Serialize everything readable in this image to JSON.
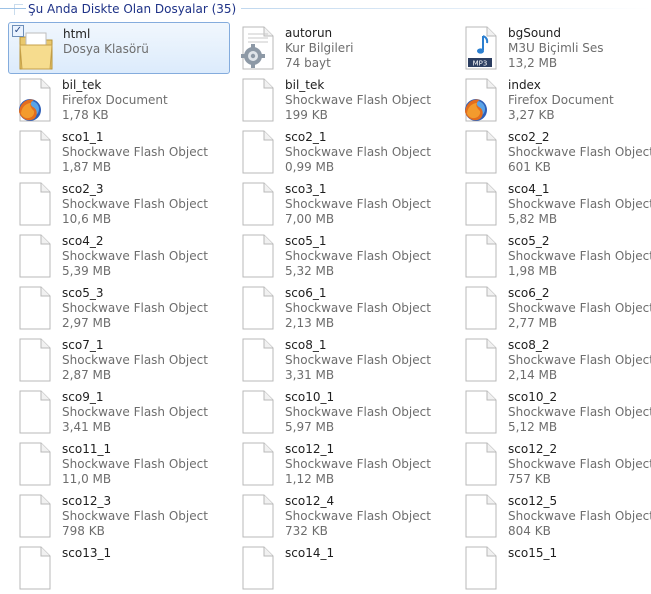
{
  "group": {
    "title": "Şu Anda Diskte Olan Dosyalar (35)"
  },
  "files": [
    {
      "name": "html",
      "type": "Dosya Klasörü",
      "size": "",
      "icon": "folder-icon",
      "selected": true
    },
    {
      "name": "autorun",
      "type": "Kur Bilgileri",
      "size": "74 bayt",
      "icon": "settings-file-icon"
    },
    {
      "name": "bgSound",
      "type": "M3U Biçimli Ses",
      "size": "13,2 MB",
      "icon": "mp3-audio-icon"
    },
    {
      "name": "bil_tek",
      "type": "Firefox Document",
      "size": "1,78 KB",
      "icon": "firefox-document-icon"
    },
    {
      "name": "bil_tek",
      "type": "Shockwave Flash Object",
      "size": "199 KB",
      "icon": "document-icon"
    },
    {
      "name": "index",
      "type": "Firefox Document",
      "size": "3,27 KB",
      "icon": "firefox-document-icon"
    },
    {
      "name": "sco1_1",
      "type": "Shockwave Flash Object",
      "size": "1,87 MB",
      "icon": "document-icon"
    },
    {
      "name": "sco2_1",
      "type": "Shockwave Flash Object",
      "size": "0,99 MB",
      "icon": "document-icon"
    },
    {
      "name": "sco2_2",
      "type": "Shockwave Flash Object",
      "size": "601 KB",
      "icon": "document-icon"
    },
    {
      "name": "sco2_3",
      "type": "Shockwave Flash Object",
      "size": "10,6 MB",
      "icon": "document-icon"
    },
    {
      "name": "sco3_1",
      "type": "Shockwave Flash Object",
      "size": "7,00 MB",
      "icon": "document-icon"
    },
    {
      "name": "sco4_1",
      "type": "Shockwave Flash Object",
      "size": "5,82 MB",
      "icon": "document-icon"
    },
    {
      "name": "sco4_2",
      "type": "Shockwave Flash Object",
      "size": "5,39 MB",
      "icon": "document-icon"
    },
    {
      "name": "sco5_1",
      "type": "Shockwave Flash Object",
      "size": "5,32 MB",
      "icon": "document-icon"
    },
    {
      "name": "sco5_2",
      "type": "Shockwave Flash Object",
      "size": "1,98 MB",
      "icon": "document-icon"
    },
    {
      "name": "sco5_3",
      "type": "Shockwave Flash Object",
      "size": "2,97 MB",
      "icon": "document-icon"
    },
    {
      "name": "sco6_1",
      "type": "Shockwave Flash Object",
      "size": "2,13 MB",
      "icon": "document-icon"
    },
    {
      "name": "sco6_2",
      "type": "Shockwave Flash Object",
      "size": "2,77 MB",
      "icon": "document-icon"
    },
    {
      "name": "sco7_1",
      "type": "Shockwave Flash Object",
      "size": "2,87 MB",
      "icon": "document-icon"
    },
    {
      "name": "sco8_1",
      "type": "Shockwave Flash Object",
      "size": "3,31 MB",
      "icon": "document-icon"
    },
    {
      "name": "sco8_2",
      "type": "Shockwave Flash Object",
      "size": "2,14 MB",
      "icon": "document-icon"
    },
    {
      "name": "sco9_1",
      "type": "Shockwave Flash Object",
      "size": "3,41 MB",
      "icon": "document-icon"
    },
    {
      "name": "sco10_1",
      "type": "Shockwave Flash Object",
      "size": "5,97 MB",
      "icon": "document-icon"
    },
    {
      "name": "sco10_2",
      "type": "Shockwave Flash Object",
      "size": "5,12 MB",
      "icon": "document-icon"
    },
    {
      "name": "sco11_1",
      "type": "Shockwave Flash Object",
      "size": "11,0 MB",
      "icon": "document-icon"
    },
    {
      "name": "sco12_1",
      "type": "Shockwave Flash Object",
      "size": "1,12 MB",
      "icon": "document-icon"
    },
    {
      "name": "sco12_2",
      "type": "Shockwave Flash Object",
      "size": "757 KB",
      "icon": "document-icon"
    },
    {
      "name": "sco12_3",
      "type": "Shockwave Flash Object",
      "size": "798 KB",
      "icon": "document-icon"
    },
    {
      "name": "sco12_4",
      "type": "Shockwave Flash Object",
      "size": "732 KB",
      "icon": "document-icon"
    },
    {
      "name": "sco12_5",
      "type": "Shockwave Flash Object",
      "size": "804 KB",
      "icon": "document-icon"
    },
    {
      "name": "sco13_1",
      "type": "",
      "size": "",
      "icon": "document-icon"
    },
    {
      "name": "sco14_1",
      "type": "",
      "size": "",
      "icon": "document-icon"
    },
    {
      "name": "sco15_1",
      "type": "",
      "size": "",
      "icon": "document-icon"
    }
  ]
}
